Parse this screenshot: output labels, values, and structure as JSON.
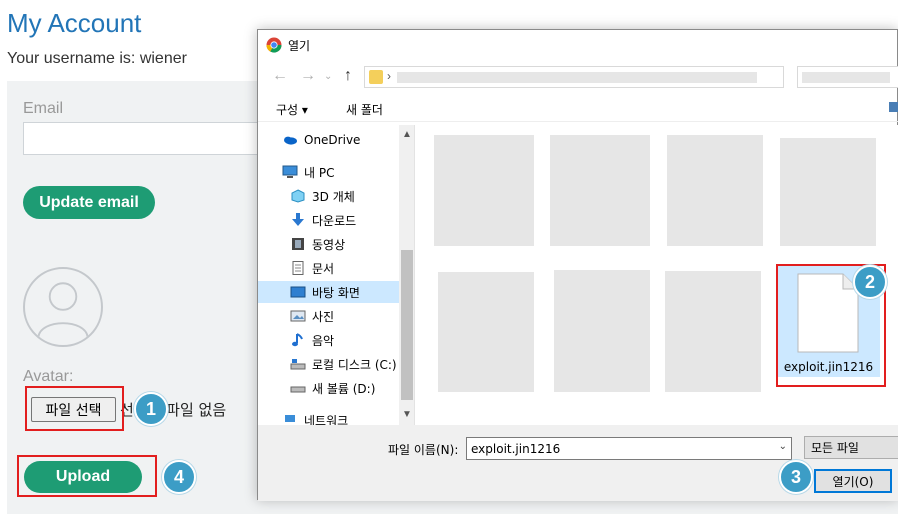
{
  "account": {
    "title": "My Account",
    "username_text": "Your username is: wiener",
    "email_label": "Email",
    "update_email_button": "Update email",
    "avatar_label": "Avatar:",
    "choose_file_button": "파일 선택",
    "no_file_text": "선택된 파일 없음",
    "upload_button": "Upload",
    "brand_color": "#1e9c74",
    "title_color": "#2275b7"
  },
  "steps": {
    "one": "1",
    "two": "2",
    "three": "3",
    "four": "4",
    "highlight_color": "#e21e1e",
    "badge_color": "#3c9dc6"
  },
  "dialog": {
    "title": "열기",
    "toolbar": {
      "organize": "구성 ▾",
      "new_folder": "새 폴더"
    },
    "nav_items": [
      {
        "label": "OneDrive",
        "icon": "onedrive-icon"
      },
      {
        "label": "내 PC",
        "icon": "pc-icon"
      },
      {
        "label": "3D 개체",
        "icon": "3d-objects-icon"
      },
      {
        "label": "다운로드",
        "icon": "download-icon"
      },
      {
        "label": "동영상",
        "icon": "video-icon"
      },
      {
        "label": "문서",
        "icon": "document-icon"
      },
      {
        "label": "바탕 화면",
        "icon": "desktop-icon",
        "selected": true
      },
      {
        "label": "사진",
        "icon": "pictures-icon"
      },
      {
        "label": "음악",
        "icon": "music-icon"
      },
      {
        "label": "로컬 디스크 (C:)",
        "icon": "drive-icon"
      },
      {
        "label": "새 볼륨 (D:)",
        "icon": "drive-icon"
      },
      {
        "label": "네트워크",
        "icon": "network-icon"
      }
    ],
    "selected_file": "exploit.jin1216",
    "filename_label": "파일 이름(N):",
    "filename_value": "exploit.jin1216",
    "filetype_value": "모든 파일",
    "open_button": "열기(O)"
  }
}
